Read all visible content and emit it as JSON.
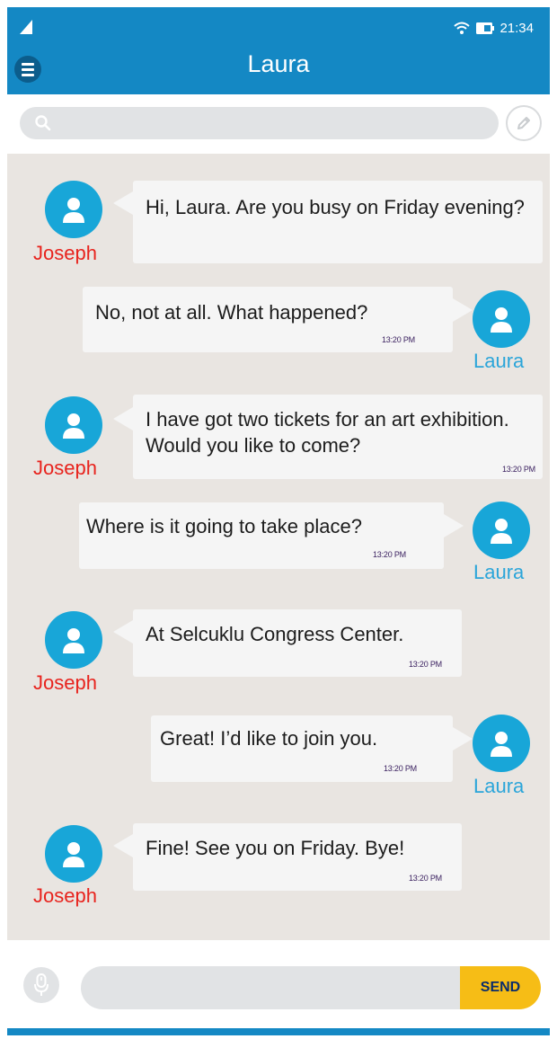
{
  "status_bar": {
    "time": "21:34"
  },
  "header": {
    "title": "Laura"
  },
  "search": {
    "placeholder": ""
  },
  "composer": {
    "placeholder": "",
    "send_label": "SEND"
  },
  "messages": [
    {
      "sender": "Joseph",
      "text": "Hi, Laura. Are you busy on Friday evening?",
      "time": ""
    },
    {
      "sender": "Laura",
      "text": "No, not at all. What happened?",
      "time": "13:20 PM"
    },
    {
      "sender": "Joseph",
      "text": "I have got two tickets for an art exhibition. Would you like to come?",
      "time": "13:20 PM"
    },
    {
      "sender": "Laura",
      "text": "Where is it going to take place?",
      "time": "13:20 PM"
    },
    {
      "sender": "Joseph",
      "text": "At Selcuklu Congress Center.",
      "time": "13:20 PM"
    },
    {
      "sender": "Laura",
      "text": "Great! I’d like to join you.",
      "time": "13:20 PM"
    },
    {
      "sender": "Joseph",
      "text": "Fine! See you on Friday. Bye!",
      "time": "13:20 PM"
    }
  ],
  "colors": {
    "header": "#1488c4",
    "avatar": "#18a6d8",
    "joseph_name": "#e8231d",
    "laura_name": "#2ba5d9",
    "chat_background": "#e9e5e1",
    "send_button": "#f6bd16"
  },
  "icons": {
    "signal": "signal-icon",
    "wifi": "wifi-icon",
    "battery": "battery-icon",
    "menu": "hamburger-menu-icon",
    "search": "search-icon",
    "compose": "pencil-icon",
    "avatar": "user-icon",
    "mic": "microphone-icon"
  }
}
